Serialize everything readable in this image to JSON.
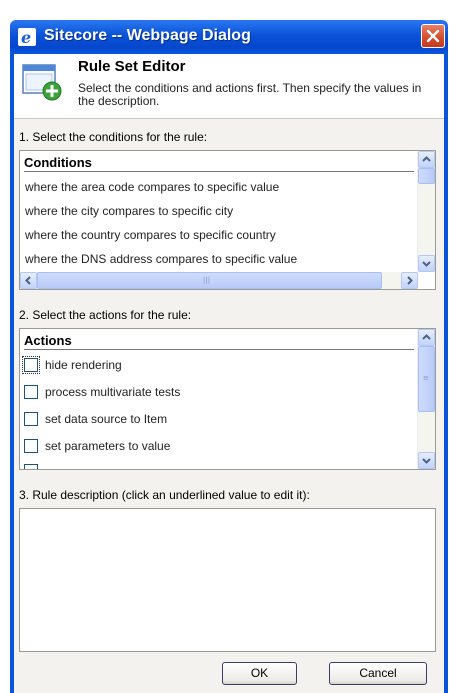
{
  "window": {
    "title": "Sitecore -- Webpage Dialog"
  },
  "header": {
    "title": "Rule Set Editor",
    "description": "Select the conditions and actions first. Then specify the values in the description."
  },
  "conditions_section": {
    "label": "1. Select the conditions for the rule:",
    "list_header": "Conditions",
    "items": [
      "where the area code compares to specific value",
      "where the city compares to specific city",
      "where the country compares to specific country",
      "where the DNS address compares to specific value"
    ]
  },
  "actions_section": {
    "label": "2. Select the actions for the rule:",
    "list_header": "Actions",
    "items": [
      {
        "label": "hide rendering",
        "checked": false
      },
      {
        "label": "process multivariate tests",
        "checked": false
      },
      {
        "label": "set data source to Item",
        "checked": false
      },
      {
        "label": "set parameters to value",
        "checked": false
      }
    ]
  },
  "description_section": {
    "label": "3. Rule description (click an underlined value to edit it):"
  },
  "buttons": {
    "ok": "OK",
    "cancel": "Cancel"
  },
  "colors": {
    "titlebar": "#0a52d8",
    "close": "#d34a2c",
    "panel_bg": "#f3f2ee"
  }
}
